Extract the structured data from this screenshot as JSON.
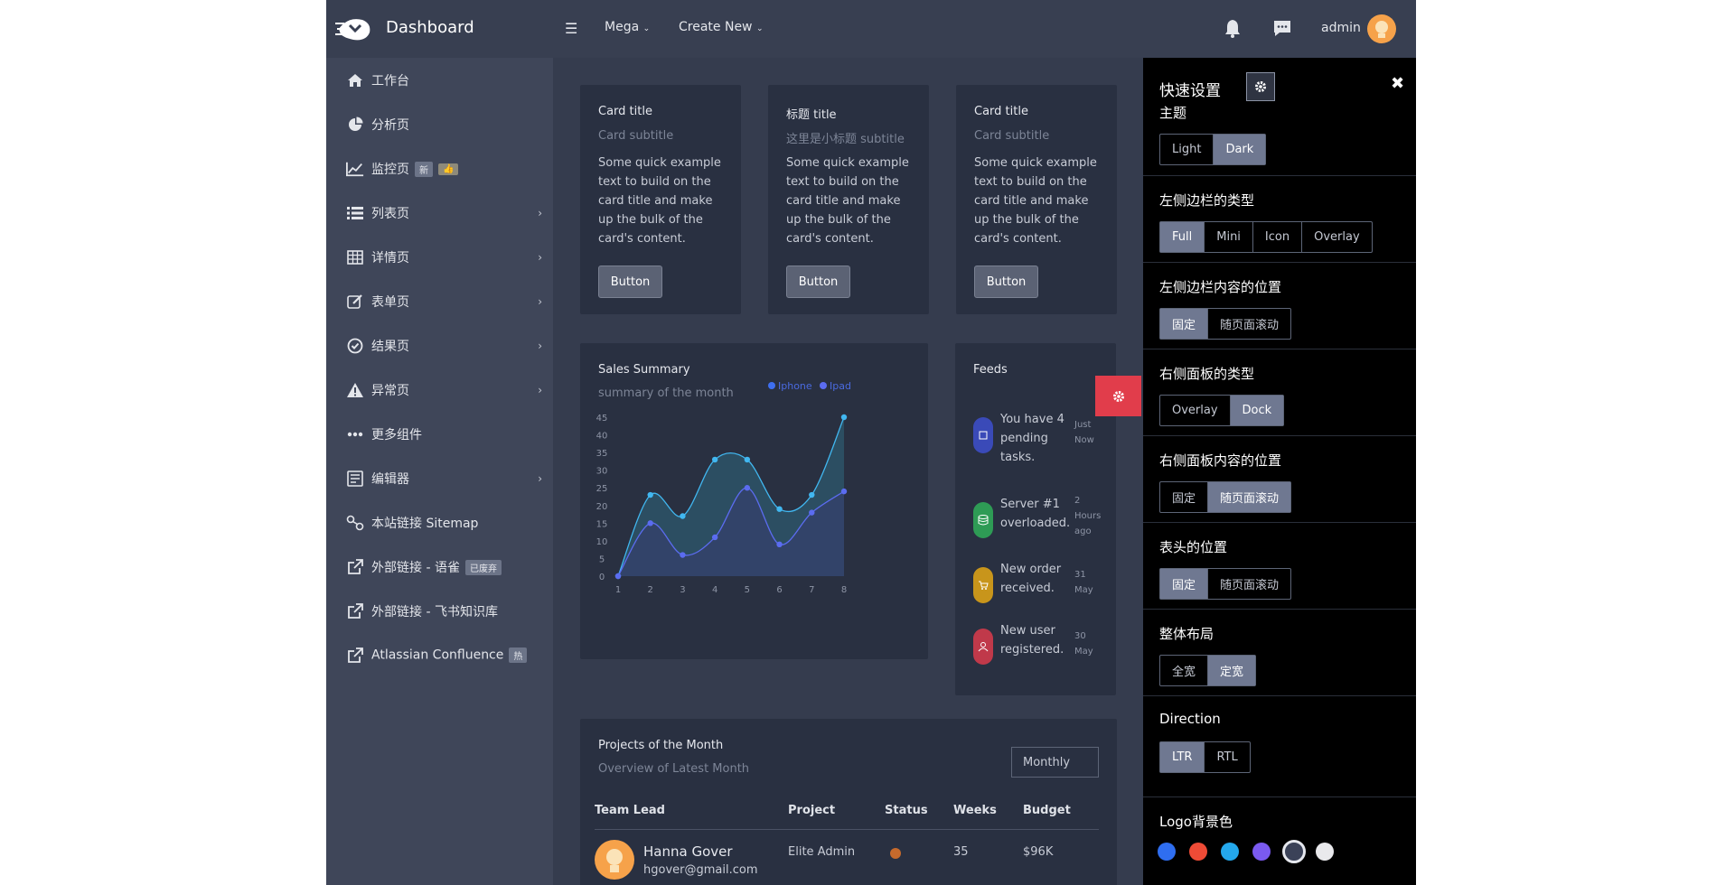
{
  "topbar": {
    "brand": "Dashboard",
    "menu1": "Mega",
    "menu2": "Create New",
    "user": "admin"
  },
  "sidebar": {
    "items": [
      {
        "label": "工作台",
        "icon": "home-icon"
      },
      {
        "label": "分析页",
        "icon": "pie-chart-icon"
      },
      {
        "label": "监控页",
        "icon": "line-chart-icon",
        "badges": [
          "新",
          "👍"
        ]
      },
      {
        "label": "列表页",
        "icon": "list-icon"
      },
      {
        "label": "详情页",
        "icon": "table-icon"
      },
      {
        "label": "表单页",
        "icon": "edit-icon"
      },
      {
        "label": "结果页",
        "icon": "check-circle-icon"
      },
      {
        "label": "异常页",
        "icon": "warning-icon"
      },
      {
        "label": "更多组件",
        "icon": "dots-icon"
      },
      {
        "label": "编辑器",
        "icon": "editor-icon"
      },
      {
        "label": "本站链接 Sitemap",
        "icon": "sitemap-icon"
      },
      {
        "label": "外部链接 - 语雀",
        "icon": "external-link-icon",
        "badges": [
          "已废弃"
        ]
      },
      {
        "label": "外部链接 - 飞书知识库",
        "icon": "external-link-icon"
      },
      {
        "label": "Atlassian Confluence",
        "icon": "external-link-icon",
        "badges": [
          "热"
        ]
      }
    ]
  },
  "cards": [
    {
      "title": "Card title",
      "subtitle": "Card subtitle",
      "text": "Some quick example text to build on the card title and make up the bulk of the card's content.",
      "button": "Button"
    },
    {
      "title": "标题 title",
      "subtitle": "这里是小标题 subtitle",
      "text": "Some quick example text to build on the card title and make up the bulk of the card's content.",
      "button": "Button"
    },
    {
      "title": "Card title",
      "subtitle": "Card subtitle",
      "text": "Some quick example text to build on the card title and make up the bulk of the card's content.",
      "button": "Button"
    }
  ],
  "sales": {
    "title": "Sales Summary",
    "subtitle": "summary of the month"
  },
  "chart_data": {
    "type": "area",
    "title": "Sales Summary",
    "subtitle": "summary of the month",
    "x": [
      1,
      2,
      3,
      4,
      5,
      6,
      7,
      8
    ],
    "series": [
      {
        "name": "Iphone",
        "values": [
          0,
          23,
          17,
          33,
          33,
          19,
          23,
          45
        ]
      },
      {
        "name": "Ipad",
        "values": [
          0,
          15,
          6,
          11,
          25,
          9,
          18,
          24
        ]
      }
    ],
    "ylim": [
      0,
      45
    ],
    "yticks": [
      "0",
      "5",
      "10",
      "15",
      "20",
      "25",
      "30",
      "35",
      "40",
      "45"
    ],
    "xticks": [
      "1",
      "2",
      "3",
      "4",
      "5",
      "6",
      "7",
      "8"
    ],
    "legend": "top-right",
    "colors": [
      "#41b7f0",
      "#5b6cf0"
    ]
  },
  "feeds": {
    "title": "Feeds",
    "items": [
      {
        "text": "You have 4 pending tasks.",
        "time": "Just Now",
        "color": "#3a4ab8",
        "icon": "bell-icon"
      },
      {
        "text": "Server #1 overloaded.",
        "time": "2 Hours ago",
        "color": "#2e9b55",
        "icon": "server-icon"
      },
      {
        "text": "New order received.",
        "time": "31 May",
        "color": "#c8951b",
        "icon": "cart-icon"
      },
      {
        "text": "New user registered.",
        "time": "30 May",
        "color": "#c0394a",
        "icon": "user-icon"
      }
    ]
  },
  "projects": {
    "title": "Projects of the Month",
    "subtitle": "Overview of Latest Month",
    "select": "Monthly",
    "headers": [
      "Team Lead",
      "Project",
      "Status",
      "Weeks",
      "Budget"
    ],
    "rows": [
      {
        "name": "Hanna Gover",
        "email": "hgover@gmail.com",
        "project": "Elite Admin",
        "weeks": "35",
        "budget": "$96K",
        "status_color": "#c66a2c"
      }
    ]
  },
  "panel": {
    "title": "快速设置",
    "sections": [
      {
        "label": "主题",
        "options": [
          "Light",
          "Dark"
        ],
        "active": 1
      },
      {
        "label": "左侧边栏的类型",
        "options": [
          "Full",
          "Mini",
          "Icon",
          "Overlay"
        ],
        "active": 0
      },
      {
        "label": "左侧边栏内容的位置",
        "options": [
          "固定",
          "随页面滚动"
        ],
        "active": 0
      },
      {
        "label": "右侧面板的类型",
        "options": [
          "Overlay",
          "Dock"
        ],
        "active": 1
      },
      {
        "label": "右侧面板内容的位置",
        "options": [
          "固定",
          "随页面滚动"
        ],
        "active": 1
      },
      {
        "label": "表头的位置",
        "options": [
          "固定",
          "随页面滚动"
        ],
        "active": 0
      },
      {
        "label": "整体布局",
        "options": [
          "全宽",
          "定宽"
        ],
        "active": 1
      },
      {
        "label": "Direction",
        "options": [
          "LTR",
          "RTL"
        ],
        "active": 0
      }
    ],
    "logo_bg_label": "Logo背景色",
    "swatches": [
      "#2f6ef0",
      "#ef4b36",
      "#24a8ec",
      "#7a5af0",
      "#3b4258",
      "#e9e9ec"
    ]
  }
}
